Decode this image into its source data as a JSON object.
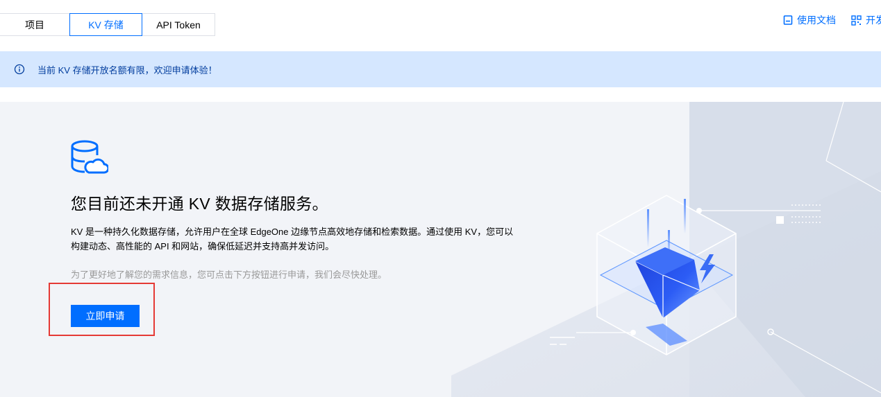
{
  "tabs": [
    {
      "label": "项目",
      "active": false
    },
    {
      "label": "KV 存储",
      "active": true
    },
    {
      "label": "API Token",
      "active": false
    }
  ],
  "toplinks": {
    "docs_label": "使用文档",
    "docs_icon": "book-icon",
    "second_label": "开发",
    "second_icon": "qrcode-icon"
  },
  "notice": {
    "icon": "info-icon",
    "text": "当前 KV 存储开放名额有限，欢迎申请体验！"
  },
  "hero": {
    "icon": "database-cloud-icon",
    "title": "您目前还未开通 KV 数据存储服务。",
    "description": "KV 是一种持久化数据存储，允许用户在全球 EdgeOne 边缘节点高效地存储和检索数据。通过使用 KV，您可以构建动态、高性能的 API 和网站，确保低延迟并支持高并发访问。",
    "hint": "为了更好地了解您的需求信息，您可点击下方按钮进行申请，我们会尽快处理。",
    "apply_label": "立即申请"
  },
  "colors": {
    "accent": "#006eff",
    "notice_bg": "#d5e7ff",
    "hero_bg": "#f2f4f8",
    "highlight": "#e53935"
  }
}
